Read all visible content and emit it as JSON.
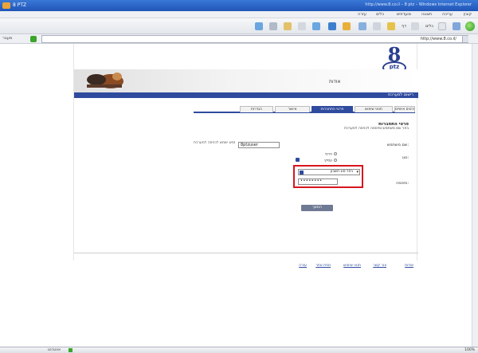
{
  "window": {
    "app_label": "8 PTZ",
    "title": "http://www.8.co.il – 8 ptz – Windows Internet Explorer"
  },
  "menubar": {
    "items": [
      "קובץ",
      "עריכה",
      "תצוגה",
      "מועדפים",
      "כלים",
      "עזרה"
    ]
  },
  "toolbar": {
    "labels": [
      "דף",
      "כלים"
    ]
  },
  "addressbar": {
    "go_label": "מעבר",
    "url": "http://www.8.co.il/"
  },
  "site": {
    "logo": {
      "digit": "8",
      "text": "ptz"
    },
    "banner_title": "אודות",
    "bluebar_text": "רישום למערכת",
    "tabs": [
      {
        "label": "פרטים אישיים",
        "active": false
      },
      {
        "label": "תנאי שימוש",
        "active": false
      },
      {
        "label": "פרטי התחברות",
        "active": true
      },
      {
        "label": "אישור",
        "active": false
      },
      {
        "label": "הגדרות",
        "active": false
      }
    ],
    "section_title": "פרטי התחברות",
    "section_desc": "בחר שם משתמש וסיסמה לכניסה למערכת",
    "username_label": "שם משתמש:",
    "username_value": "8ptzuser",
    "username_hint": "שם המשתמש ישמש לכניסה למערכת",
    "radio_label": "סוג:",
    "radio_options": [
      "פרטי",
      "עסקי"
    ],
    "select_value": "בחר סוג חשבון",
    "password_label": "סיסמה:",
    "password_value": "••••••••",
    "submit_label": "המשך",
    "footer_links": [
      "אודות",
      "צור קשר",
      "תנאי שימוש",
      "מפת אתר",
      "עזרה"
    ]
  },
  "statusbar": {
    "status": "אינטרנט",
    "zone": "100%"
  },
  "colors": {
    "accent": "#2f4b9e",
    "highlight": "#d8141e",
    "titlebar": "#1f55b8"
  }
}
